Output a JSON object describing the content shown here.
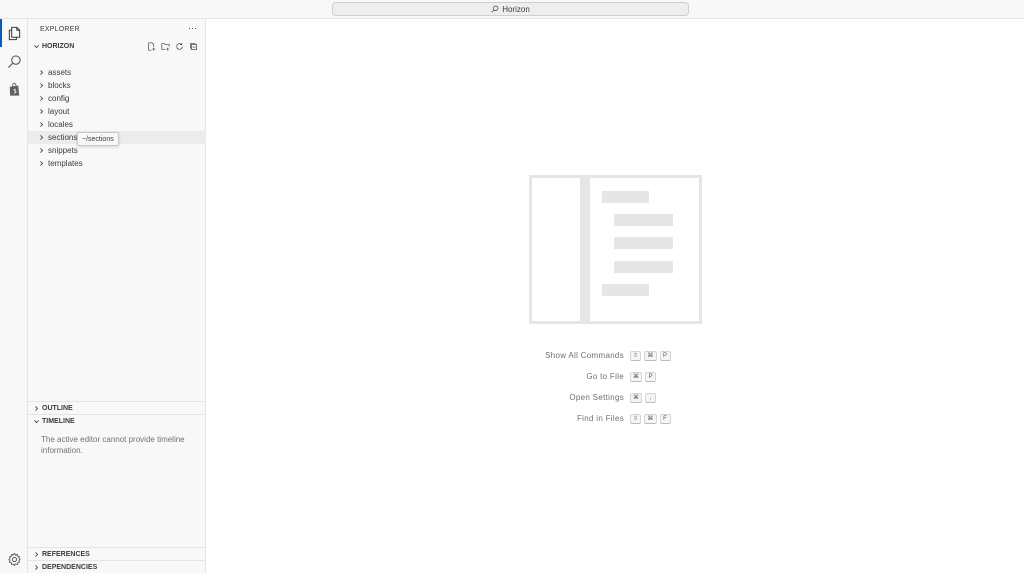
{
  "window": {
    "search_label": "Horizon"
  },
  "activity_bar": {
    "items": [
      {
        "name": "explorer",
        "icon": "files-icon",
        "active": true
      },
      {
        "name": "search",
        "icon": "search-icon",
        "active": false
      },
      {
        "name": "shopify",
        "icon": "shopping-bag-icon",
        "active": false
      }
    ],
    "bottom": {
      "icon": "gear-icon"
    }
  },
  "sidebar": {
    "title": "EXPLORER",
    "more": "···",
    "workspace": {
      "label": "HORIZON",
      "actions": [
        "new-file-icon",
        "new-folder-icon",
        "refresh-icon",
        "collapse-all-icon"
      ]
    },
    "folders": [
      {
        "label": "assets"
      },
      {
        "label": "blocks"
      },
      {
        "label": "config"
      },
      {
        "label": "layout"
      },
      {
        "label": "locales"
      },
      {
        "label": "sections"
      },
      {
        "label": "snippets"
      },
      {
        "label": "templates"
      }
    ],
    "tooltip": "~/sections",
    "outline_label": "OUTLINE",
    "timeline_label": "TIMELINE",
    "timeline_message": "The active editor cannot provide timeline information.",
    "references_label": "REFERENCES",
    "dependencies_label": "DEPENDENCIES"
  },
  "editor": {
    "shortcuts": [
      {
        "label": "Show All Commands",
        "keys": [
          "⇧",
          "⌘",
          "P"
        ]
      },
      {
        "label": "Go to File",
        "keys": [
          "⌘",
          "P"
        ]
      },
      {
        "label": "Open Settings",
        "keys": [
          "⌘",
          ","
        ]
      },
      {
        "label": "Find in Files",
        "keys": [
          "⇧",
          "⌘",
          "F"
        ]
      }
    ]
  },
  "colors": {
    "accent": "#005fb8",
    "sidebar_bg": "#f8f8f8",
    "border": "#e5e5e5",
    "watermark": "#e6e6e6"
  }
}
